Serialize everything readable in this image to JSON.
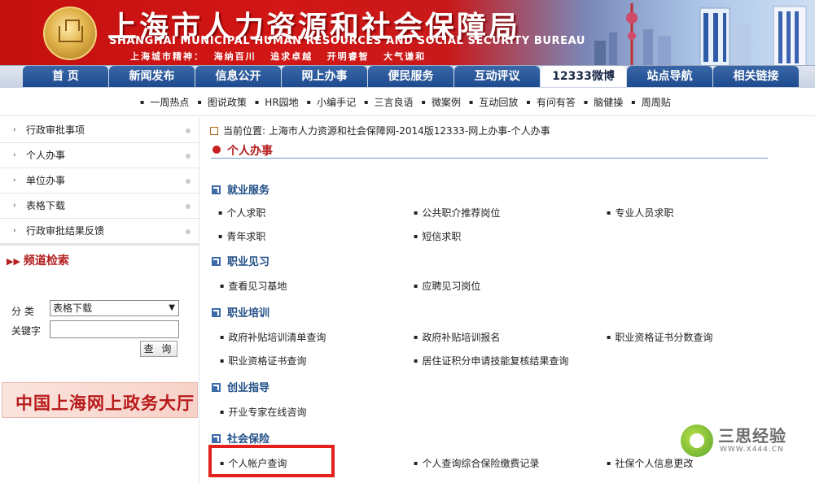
{
  "header": {
    "title_cn": "上海市人力资源和社会保障局",
    "title_en": "SHANGHAI MUNICIPAL HUMAN RESOURCES AND SOCIAL SECURITY BUREAU",
    "motto": "上海城市精神：  海纳百川   追求卓越   开明睿智   大气谦和"
  },
  "nav": {
    "tabs": [
      {
        "label": "首  页",
        "active": false
      },
      {
        "label": "新闻发布",
        "active": false
      },
      {
        "label": "信息公开",
        "active": false
      },
      {
        "label": "网上办事",
        "active": false
      },
      {
        "label": "便民服务",
        "active": false
      },
      {
        "label": "互动评议",
        "active": false
      },
      {
        "label": "12333微博",
        "active": true
      },
      {
        "label": "站点导航",
        "active": false
      },
      {
        "label": "相关链接",
        "active": false
      }
    ]
  },
  "subnav": {
    "items": [
      "一周热点",
      "图说政策",
      "HR园地",
      "小编手记",
      "三言良语",
      "微案例",
      "互动回放",
      "有问有答",
      "脑健操",
      "周周贴"
    ]
  },
  "sidebar": {
    "items": [
      {
        "label": "行政审批事项"
      },
      {
        "label": "个人办事"
      },
      {
        "label": "单位办事"
      },
      {
        "label": "表格下载"
      },
      {
        "label": "行政审批结果反馈"
      }
    ],
    "search": {
      "title": "频道检索",
      "category_label": "分  类",
      "category_value": "表格下载",
      "keyword_label": "关键字",
      "keyword_value": "",
      "button_label": "查 询"
    },
    "banner_text": "中国上海网上政务大厅"
  },
  "main": {
    "breadcrumb": "当前位置: 上海市人力资源和社会保障网-2014版12333-网上办事-个人办事",
    "heading": "个人办事",
    "sections": [
      {
        "title": "就业服务",
        "links": [
          "个人求职",
          "公共职介推荐岗位",
          "专业人员求职",
          "青年求职",
          "短信求职"
        ]
      },
      {
        "title": "职业见习",
        "links": [
          "查看见习基地",
          "应聘见习岗位"
        ]
      },
      {
        "title": "职业培训",
        "links": [
          "政府补贴培训清单查询",
          "政府补贴培训报名",
          "职业资格证书分数查询",
          "职业资格证书查询",
          "居住证积分申请技能复核结果查询"
        ]
      },
      {
        "title": "创业指导",
        "links": [
          "开业专家在线咨询"
        ]
      },
      {
        "title": "社会保险",
        "links": [
          "个人帐户查询",
          "个人查询综合保险缴费记录",
          "社保个人信息更改"
        ]
      }
    ]
  },
  "watermark": {
    "text": "三思经验",
    "url": "WWW.X444.CN"
  },
  "colors": {
    "banner_red": "#c4100f",
    "nav_blue": "#1e4b8e",
    "section_blue": "#1f4e86",
    "heading_red": "#b41e1e",
    "highlight_red": "#e3201b"
  }
}
